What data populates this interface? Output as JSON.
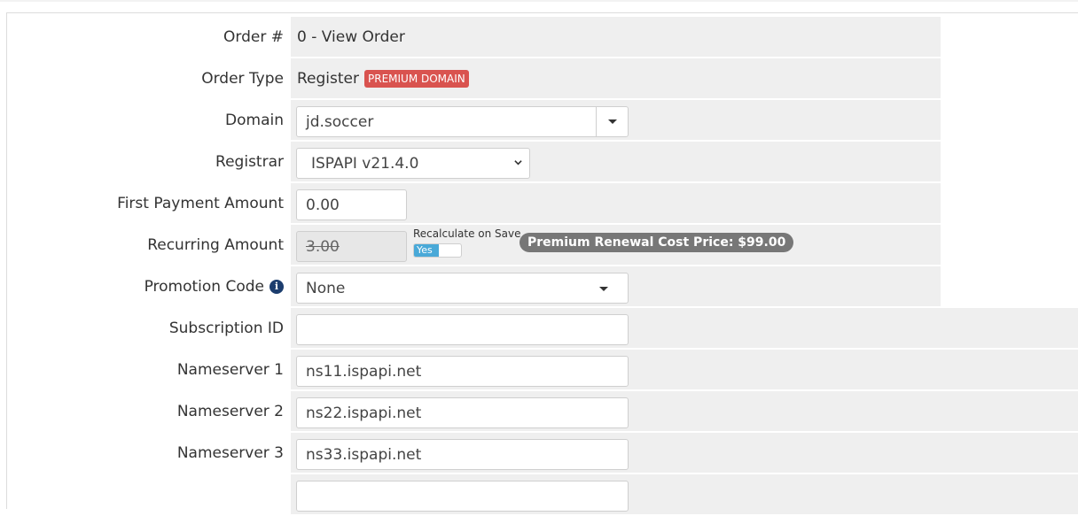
{
  "form": {
    "order_number": {
      "label": "Order #",
      "value": "0 - View Order"
    },
    "order_type": {
      "label": "Order Type",
      "value": "Register",
      "badge": "PREMIUM DOMAIN"
    },
    "domain": {
      "label": "Domain",
      "value": "jd.soccer"
    },
    "registrar": {
      "label": "Registrar",
      "value": "ISPAPI v21.4.0"
    },
    "first_payment": {
      "label": "First Payment Amount",
      "value": "0.00"
    },
    "recurring": {
      "label": "Recurring Amount",
      "value": "3.00",
      "recalc_label": "Recalculate on Save",
      "toggle_label": "Yes",
      "renewal_badge": "Premium Renewal Cost Price: $99.00"
    },
    "promotion": {
      "label": "Promotion Code",
      "value": "None"
    },
    "subscription": {
      "label": "Subscription ID",
      "value": ""
    },
    "ns1": {
      "label": "Nameserver 1",
      "value": "ns11.ispapi.net"
    },
    "ns2": {
      "label": "Nameserver 2",
      "value": "ns22.ispapi.net"
    },
    "ns3": {
      "label": "Nameserver 3",
      "value": "ns33.ispapi.net"
    }
  },
  "colors": {
    "badge_red": "#d9534f",
    "toggle_blue": "#49a9d8",
    "info_icon": "#1c3d6e"
  },
  "icons": {
    "promotion_info": "info-icon",
    "dropdown": "caret-down-icon"
  }
}
